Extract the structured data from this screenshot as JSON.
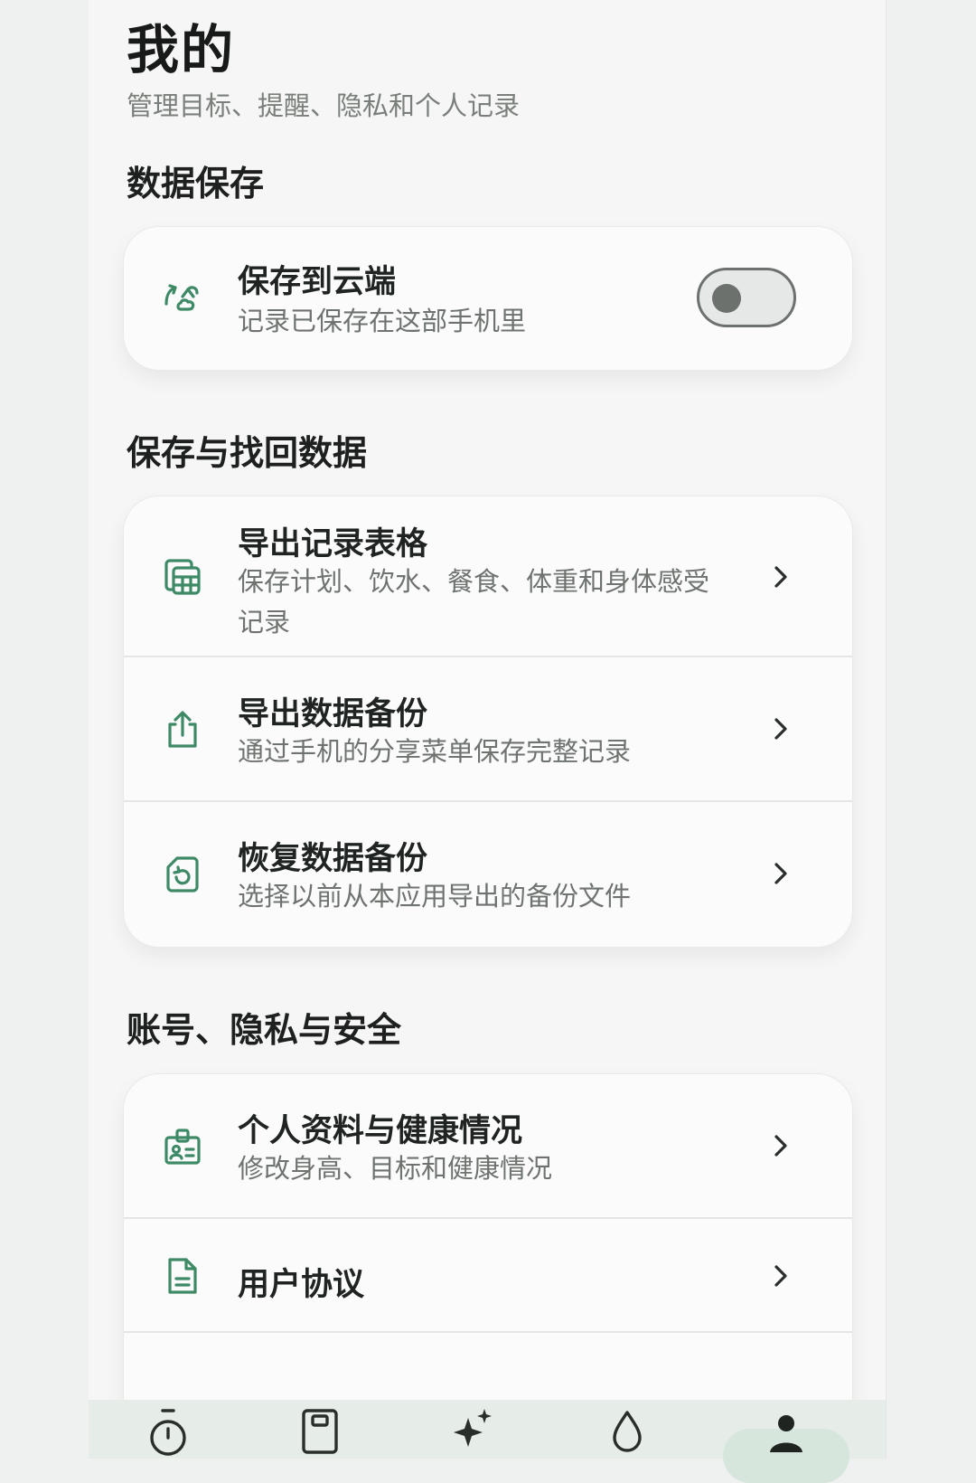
{
  "header": {
    "title": "我的",
    "subtitle": "管理目标、提醒、隐私和个人记录"
  },
  "sections": {
    "storage": {
      "title": "数据保存",
      "cloud": {
        "label": "保存到云端",
        "desc": "记录已保存在这部手机里",
        "icon": "cloud-sync-icon",
        "toggle_on": false
      }
    },
    "backup": {
      "title": "保存与找回数据",
      "items": [
        {
          "label": "导出记录表格",
          "desc": "保存计划、饮水、餐食、体重和身体感受记录",
          "icon": "spreadsheet-icon"
        },
        {
          "label": "导出数据备份",
          "desc": "通过手机的分享菜单保存完整记录",
          "icon": "share-export-icon"
        },
        {
          "label": "恢复数据备份",
          "desc": "选择以前从本应用导出的备份文件",
          "icon": "restore-file-icon"
        }
      ]
    },
    "account": {
      "title": "账号、隐私与安全",
      "items": [
        {
          "label": "个人资料与健康情况",
          "desc": "修改身高、目标和健康情况",
          "icon": "profile-card-icon"
        },
        {
          "label": "用户协议",
          "desc": "",
          "icon": "document-icon"
        }
      ]
    }
  },
  "colors": {
    "accent": "#3e8a66",
    "background": "#f5f6f5",
    "card": "#fbfbfb",
    "nav_active": "#d6e6dd"
  },
  "bottom_nav": {
    "items": [
      {
        "icon": "timer-icon"
      },
      {
        "icon": "journal-icon"
      },
      {
        "icon": "sparkle-icon"
      },
      {
        "icon": "water-drop-icon"
      },
      {
        "icon": "profile-icon",
        "active": true
      }
    ]
  }
}
